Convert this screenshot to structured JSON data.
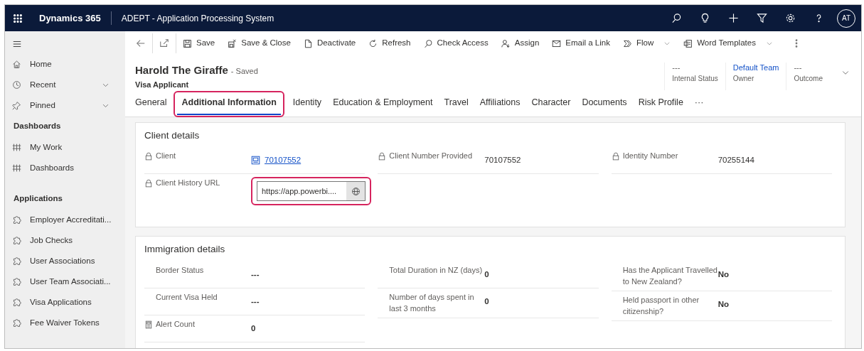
{
  "top_bar": {
    "app_name": "Dynamics 365",
    "title": "ADEPT - Application Processing System",
    "avatar": "AT"
  },
  "sidebar": {
    "items": [
      {
        "label": "Home",
        "expandable": false
      },
      {
        "label": "Recent",
        "expandable": true
      },
      {
        "label": "Pinned",
        "expandable": true
      }
    ],
    "sections": [
      {
        "title": "Dashboards",
        "items": [
          {
            "label": "My Work"
          },
          {
            "label": "Dashboards"
          }
        ]
      },
      {
        "title": "Applications",
        "items": [
          {
            "label": "Employer Accreditati..."
          },
          {
            "label": "Job Checks"
          },
          {
            "label": "User Associations"
          },
          {
            "label": "User Team Associati..."
          },
          {
            "label": "Visa Applications"
          },
          {
            "label": "Fee Waiver Tokens"
          }
        ]
      }
    ]
  },
  "command_bar": [
    {
      "label": "Save",
      "kind": "button"
    },
    {
      "label": "Save & Close",
      "kind": "button"
    },
    {
      "label": "Deactivate",
      "kind": "button"
    },
    {
      "label": "Refresh",
      "kind": "button"
    },
    {
      "label": "Check Access",
      "kind": "button"
    },
    {
      "label": "Assign",
      "kind": "button"
    },
    {
      "label": "Email a Link",
      "kind": "button"
    },
    {
      "label": "Flow",
      "kind": "dropdown"
    },
    {
      "label": "Word Templates",
      "kind": "dropdown"
    }
  ],
  "record": {
    "name": "Harold The Giraffe",
    "status": "- Saved",
    "entity": "Visa Applicant",
    "header_fields": [
      {
        "value": "---",
        "label": "Internal Status",
        "kind": "text"
      },
      {
        "value": "Default Team",
        "label": "Owner",
        "kind": "link"
      },
      {
        "value": "---",
        "label": "Outcome",
        "kind": "text"
      }
    ]
  },
  "tabs": [
    {
      "label": "General",
      "selected": false,
      "highlighted": false
    },
    {
      "label": "Additional Information",
      "selected": true,
      "highlighted": true
    },
    {
      "label": "Identity",
      "selected": false,
      "highlighted": false
    },
    {
      "label": "Education & Employment",
      "selected": false,
      "highlighted": false
    },
    {
      "label": "Travel",
      "selected": false,
      "highlighted": false
    },
    {
      "label": "Affiliations",
      "selected": false,
      "highlighted": false
    },
    {
      "label": "Character",
      "selected": false,
      "highlighted": false
    },
    {
      "label": "Documents",
      "selected": false,
      "highlighted": false
    },
    {
      "label": "Risk Profile",
      "selected": false,
      "highlighted": false
    }
  ],
  "tabs_overflow": "···",
  "sections": [
    {
      "title": "Client details",
      "columns": [
        [
          {
            "label": "Client",
            "value": "70107552",
            "kind": "lookup",
            "locked": true,
            "highlighted": false
          },
          {
            "label": "Client History URL",
            "value": "https://app.powerbi....",
            "kind": "url",
            "locked": true,
            "highlighted": true
          }
        ],
        [
          {
            "label": "Client Number Provided",
            "value": "70107552",
            "kind": "text",
            "locked": true,
            "highlighted": false
          }
        ],
        [
          {
            "label": "Identity Number",
            "value": "70255144",
            "kind": "text",
            "locked": true,
            "highlighted": false
          }
        ]
      ]
    },
    {
      "title": "Immigration details",
      "columns": [
        [
          {
            "label": "Border Status",
            "value": "---",
            "kind": "text",
            "locked": false,
            "highlighted": false
          },
          {
            "label": "Current Visa Held",
            "value": "---",
            "kind": "text",
            "locked": false,
            "highlighted": false
          },
          {
            "label": "Alert Count",
            "value": "0",
            "kind": "calc",
            "locked": false,
            "highlighted": false
          }
        ],
        [
          {
            "label": "Total Duration in NZ (days)",
            "value": "0",
            "kind": "text",
            "locked": false,
            "highlighted": false
          },
          {
            "label": "Number of days spent in last 3 months",
            "value": "0",
            "kind": "text",
            "locked": false,
            "highlighted": false
          }
        ],
        [
          {
            "label": "Has the Applicant Travelled to New Zealand?",
            "value": "No",
            "kind": "text",
            "locked": false,
            "highlighted": false
          },
          {
            "label": "Held passport in other citizenship?",
            "value": "No",
            "kind": "text",
            "locked": false,
            "highlighted": false
          }
        ]
      ]
    }
  ]
}
